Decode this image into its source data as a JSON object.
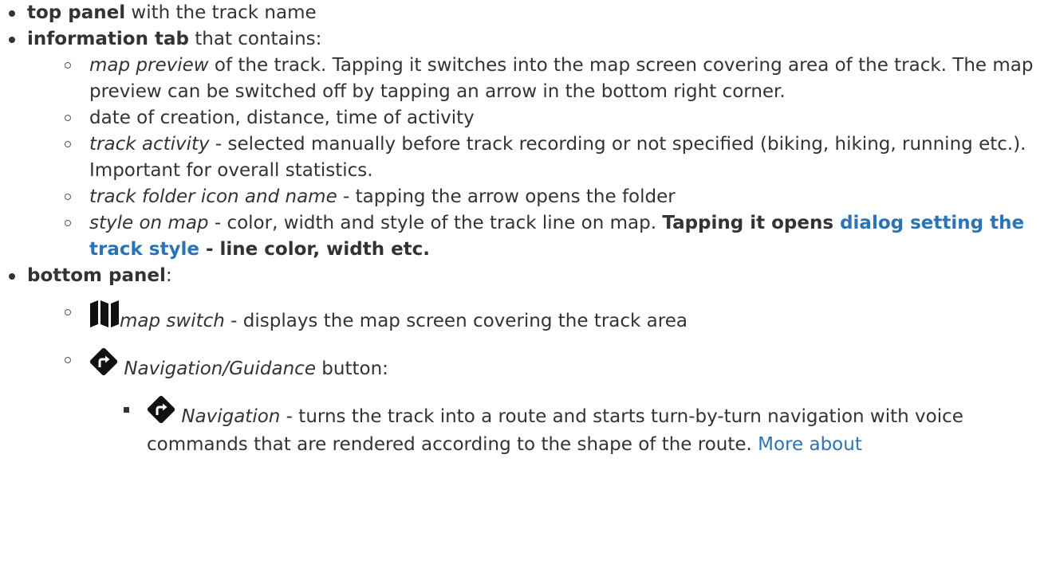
{
  "items": {
    "top_panel": {
      "bold": "top panel",
      "rest": " with the track name"
    },
    "info_tab": {
      "bold": "information tab",
      "rest": " that contains:",
      "sub": {
        "map_preview": {
          "italic": "map preview",
          "rest": " of the track. Tapping it switches into the map screen covering area of the track. The map preview can be switched off by tapping an arrow in the bottom right corner."
        },
        "date": {
          "text": "date of creation, distance, time of activity"
        },
        "activity": {
          "italic": "track activity",
          "rest": " - selected manually before track recording or not specified (biking, hiking, running etc.). Important for overall statistics."
        },
        "folder": {
          "italic": "track folder icon and name",
          "rest": " - tapping the arrow opens the folder"
        },
        "style": {
          "italic": "style on map",
          "rest": " - color, width and style of the track line on map. ",
          "bold1": "Tapping it opens ",
          "link": "dialog setting the track style",
          "bold2": " - line color, width etc."
        }
      }
    },
    "bottom_panel": {
      "bold": "bottom panel",
      "rest": ":",
      "sub": {
        "map_switch": {
          "icon": "map-icon",
          "italic": "map switch",
          "rest": " - displays the map screen covering the track area"
        },
        "nav_guidance": {
          "icon": "navigation-icon",
          "italic": "Navigation/Guidance",
          "rest": " button:",
          "sub": {
            "navigation": {
              "icon": "navigation-icon",
              "italic": "Navigation",
              "rest": " - turns the track into a route and starts turn-by-turn navigation with voice commands that are rendered according to the shape of the route. ",
              "link": "More about"
            }
          }
        }
      }
    }
  },
  "colors": {
    "text": "#333333",
    "link": "#2b73b7",
    "icon": "#111111"
  }
}
